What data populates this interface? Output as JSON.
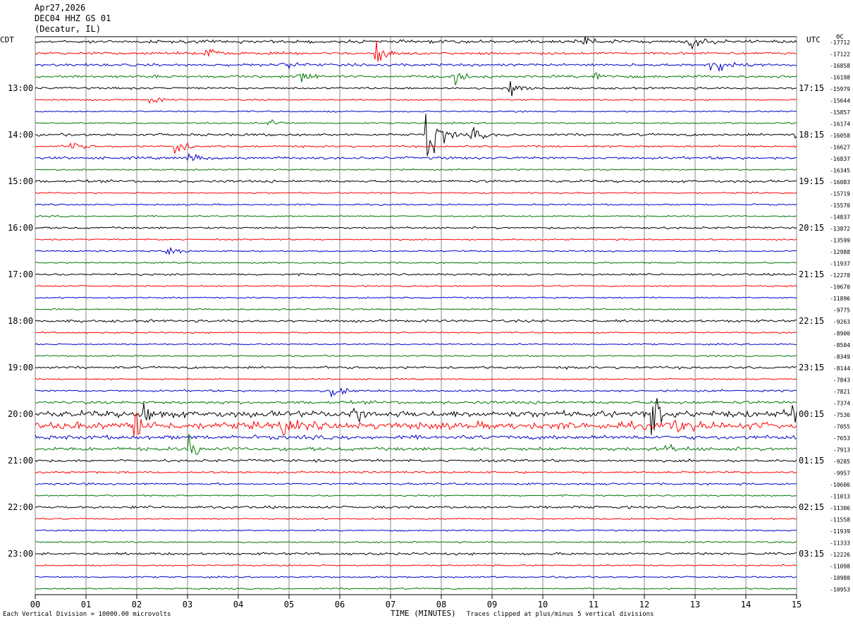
{
  "header": {
    "date": "Apr27,2026",
    "station": "DEC04 HHZ GS 01",
    "location": "(Decatur, IL)"
  },
  "left_tz": "CDT",
  "right_tz": "UTC",
  "corner_label": "0C",
  "footer": {
    "scale_note": "Each Vertical Division = 10000.00 microvolts",
    "xlabel": "TIME (MINUTES)",
    "clip_note": "Traces clipped at plus/minus 5 vertical divisions"
  },
  "colors": {
    "cycle": [
      "#000000",
      "#ff0000",
      "#0000cc",
      "#007700"
    ],
    "grid": "#888888"
  },
  "chart_data": {
    "type": "line",
    "description_type": "helicorder",
    "x_ticks": [
      "00",
      "01",
      "02",
      "03",
      "04",
      "05",
      "06",
      "07",
      "08",
      "09",
      "10",
      "11",
      "12",
      "13",
      "14",
      "15"
    ],
    "xlim": [
      0,
      15
    ],
    "left_hour_labels": [
      "13:00",
      "14:00",
      "15:00",
      "16:00",
      "17:00",
      "18:00",
      "19:00",
      "20:00",
      "21:00",
      "22:00",
      "23:00"
    ],
    "right_hour_labels": [
      "17:15",
      "18:15",
      "19:15",
      "20:15",
      "21:15",
      "22:15",
      "23:15",
      "00:15",
      "01:15",
      "02:15",
      "03:15"
    ],
    "trace_offsets": [
      "-17712",
      "-17122",
      "-16858",
      "-16198",
      "-15979",
      "-15644",
      "-15857",
      "-16174",
      "-16058",
      "-16627",
      "-16837",
      "-16345",
      "-16083",
      "-15719",
      "-15570",
      "-14837",
      "-13872",
      "-13599",
      "-12988",
      "-11937",
      "-12278",
      "-10670",
      "-11896",
      "-9775",
      "-9263",
      "-8900",
      "-8504",
      "-8349",
      "-8144",
      "-7843",
      "-7821",
      "-7374",
      "-7536",
      "-7055",
      "-7653",
      "-7913",
      "-9285",
      "-9957",
      "-10606",
      "-11013",
      "-11306",
      "-11558",
      "-11939",
      "-11333",
      "-12226",
      "-11098",
      "-10980",
      "-10953"
    ],
    "trace_noise": [
      0.06,
      0.05,
      0.05,
      0.05,
      0.04,
      0.03,
      0.03,
      0.03,
      0.05,
      0.04,
      0.05,
      0.03,
      0.05,
      0.03,
      0.03,
      0.03,
      0.04,
      0.03,
      0.03,
      0.03,
      0.04,
      0.03,
      0.03,
      0.03,
      0.05,
      0.03,
      0.03,
      0.03,
      0.05,
      0.03,
      0.04,
      0.06,
      0.12,
      0.14,
      0.08,
      0.07,
      0.05,
      0.04,
      0.04,
      0.03,
      0.05,
      0.03,
      0.03,
      0.03,
      0.05,
      0.03,
      0.03,
      0.03
    ],
    "events": [
      {
        "trace": 0,
        "minute": 10.75,
        "amp": 0.5
      },
      {
        "trace": 0,
        "minute": 12.9,
        "amp": 0.4
      },
      {
        "trace": 1,
        "minute": 3.35,
        "amp": 0.3
      },
      {
        "trace": 1,
        "minute": 6.7,
        "amp": 0.6
      },
      {
        "trace": 2,
        "minute": 4.85,
        "amp": 0.4
      },
      {
        "trace": 2,
        "minute": 13.3,
        "amp": 1.0
      },
      {
        "trace": 3,
        "minute": 5.15,
        "amp": 0.4
      },
      {
        "trace": 3,
        "minute": 8.25,
        "amp": 0.3
      },
      {
        "trace": 3,
        "minute": 11.0,
        "amp": 0.3
      },
      {
        "trace": 4,
        "minute": 9.35,
        "amp": 0.4
      },
      {
        "trace": 5,
        "minute": 2.25,
        "amp": 0.2
      },
      {
        "trace": 7,
        "minute": 4.6,
        "amp": 0.2
      },
      {
        "trace": 8,
        "minute": 7.7,
        "amp": 2.0
      },
      {
        "trace": 8,
        "minute": 8.6,
        "amp": 0.3
      },
      {
        "trace": 8,
        "minute": 14.95,
        "amp": 0.3
      },
      {
        "trace": 9,
        "minute": 2.75,
        "amp": 0.5
      },
      {
        "trace": 9,
        "minute": 0.7,
        "amp": 0.25
      },
      {
        "trace": 10,
        "minute": 3.0,
        "amp": 0.25
      },
      {
        "trace": 18,
        "minute": 2.6,
        "amp": 0.2
      },
      {
        "trace": 30,
        "minute": 5.85,
        "amp": 0.3
      },
      {
        "trace": 32,
        "minute": 2.15,
        "amp": 0.4
      },
      {
        "trace": 32,
        "minute": 6.2,
        "amp": 0.5
      },
      {
        "trace": 32,
        "minute": 12.15,
        "amp": 1.0
      },
      {
        "trace": 32,
        "minute": 14.75,
        "amp": 0.6
      },
      {
        "trace": 33,
        "minute": 1.95,
        "amp": 0.7
      },
      {
        "trace": 33,
        "minute": 4.8,
        "amp": 0.5
      },
      {
        "trace": 33,
        "minute": 12.6,
        "amp": 0.4
      },
      {
        "trace": 35,
        "minute": 3.0,
        "amp": 0.6
      },
      {
        "trace": 35,
        "minute": 12.4,
        "amp": 0.2
      }
    ]
  }
}
